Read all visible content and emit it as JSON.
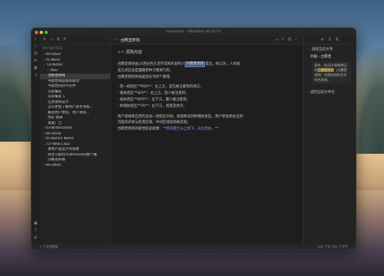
{
  "window": {
    "title": "myvchess - Obsidian v0.12.12"
  },
  "left_pane": {
    "vault_name": "MYNOTES",
    "tree": [
      {
        "label": "00-Inbox",
        "kind": "folder",
        "indent": 0
      },
      {
        "label": "01-Work",
        "kind": "folder",
        "indent": 0
      },
      {
        "label": "02-Notes",
        "kind": "open",
        "indent": 0
      },
      {
        "label": "Misc",
        "kind": "folder",
        "indent": 1
      },
      {
        "label": "古腾堡原则",
        "kind": "file",
        "indent": 1,
        "active": true
      },
      {
        "label": "平面性和层级的联动",
        "kind": "file",
        "indent": 1
      },
      {
        "label": "平面性的好坏分界",
        "kind": "file",
        "indent": 1
      },
      {
        "label": "认知偏差",
        "kind": "file",
        "indent": 1
      },
      {
        "label": "认知偏差 1",
        "kind": "file",
        "indent": 1
      },
      {
        "label": "信息架构设计",
        "kind": "file",
        "indent": 1
      },
      {
        "label": "怎么更加了解用户思考系统...",
        "kind": "file",
        "indent": 1
      },
      {
        "label": "概括用户体验、用户测试...",
        "kind": "file",
        "indent": 1
      },
      {
        "label": "色彩 图表",
        "kind": "file",
        "indent": 1
      },
      {
        "label": "重复广告",
        "kind": "file",
        "indent": 1
      },
      {
        "label": "03-Writestation",
        "kind": "folder",
        "indent": 0
      },
      {
        "label": "04-Study",
        "kind": "folder",
        "indent": 0
      },
      {
        "label": "05-Notion Notes",
        "kind": "folder",
        "indent": 0
      },
      {
        "label": "07-Web Clips",
        "kind": "open",
        "indent": 0
      },
      {
        "label": "我用产品设计的思维",
        "kind": "file",
        "indent": 1
      },
      {
        "label": "简生么配的clubhouse的整个概",
        "kind": "file",
        "indent": 1
      },
      {
        "label": "识概而开展",
        "kind": "file",
        "indent": 1
      },
      {
        "label": "99-Other",
        "kind": "folder",
        "indent": 0
      }
    ]
  },
  "editor": {
    "tab_title": "古腾堡原则",
    "heading_marker": "##",
    "heading": "原则内容",
    "para1_a": "古腾堡原则由14世纪西方活字印刷术发明人",
    "para1_hl": "古腾堡原则",
    "para1_b": "提出。他认为，人的阅",
    "para1_line2": "读方式应该是遵循某种习惯进行的。",
    "para1_line3": "古腾堡原则将画面划分为四个象限：",
    "item1": "- 第一视觉区**POA**：左上方，首先被注意到的地方；",
    "item2": "- 强休息区**SFA**：右上方，较少被注意到；",
    "item3": "- 弱休息区**WFA**：左下方，最少被注意到；",
    "item4": "- 终端休息区**TA**：右下方，视觉流终点。",
    "para2_line1": "用户视线将自然的运动一视觉区开始，逐渐移动到终端休息区。用户更容易关注到",
    "para2_line2": "页面的开始与结束区域，中间区域容易被忽视。",
    "para3_a": "古腾堡原则的视觉轨迹就像：",
    "para3_b": "**阅读重力从上到下，从左到右。**"
  },
  "right_pane": {
    "backlinks_title": "链接当前文件",
    "backlink_file": "约翰 - 古腾堡",
    "snippet_a": "此外，在设计领域常见的",
    "snippet_mark": "古腾堡原则",
    "snippet_b": "（古腾堡原则）也是由他的名字命名而来。",
    "unlinked_title": "提到当前文件名"
  },
  "status": {
    "left": "1 个反向链接",
    "right": "286 个词  762 个字符"
  }
}
